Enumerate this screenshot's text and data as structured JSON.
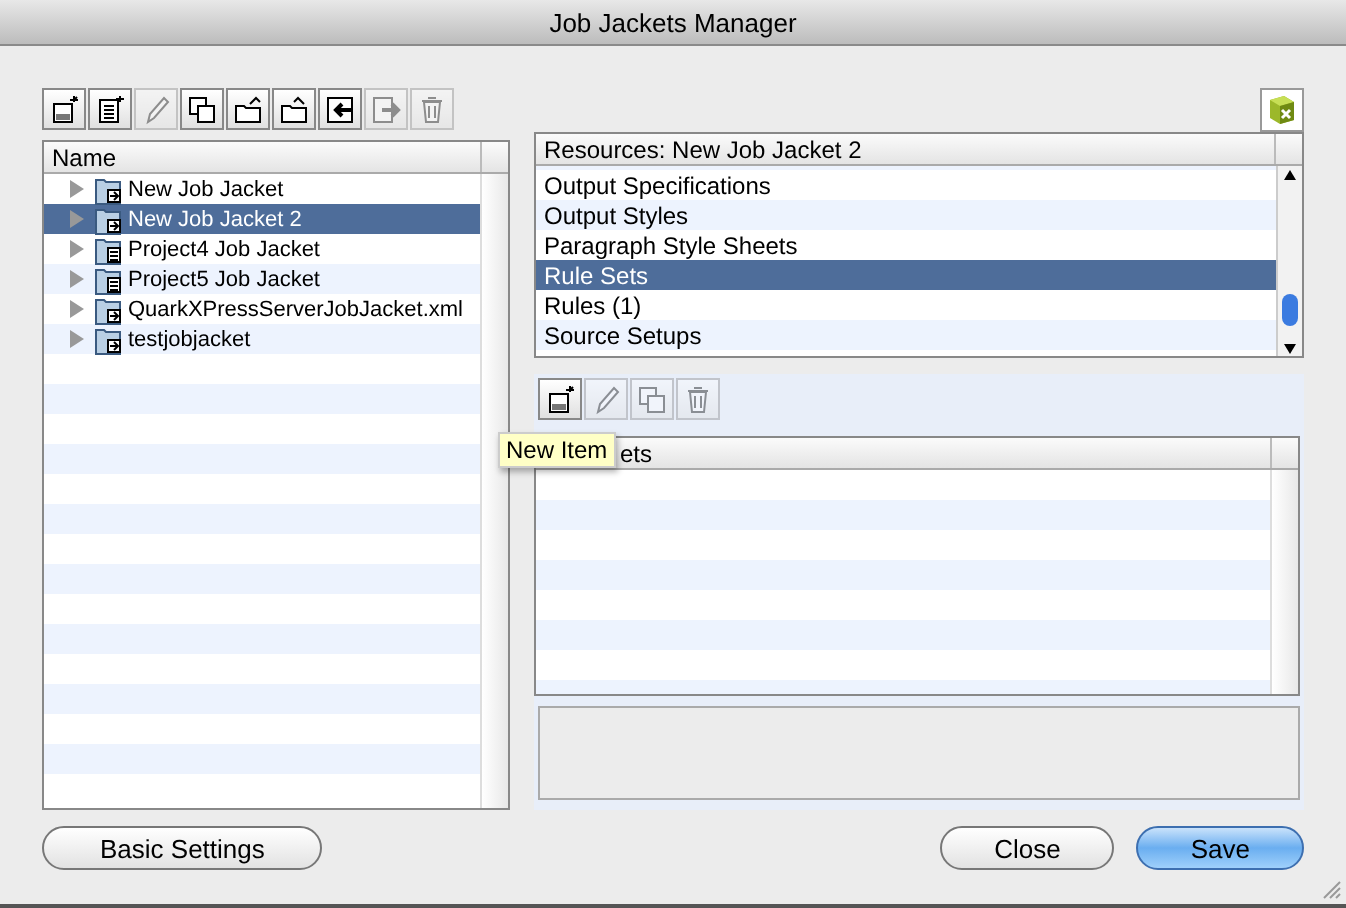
{
  "window": {
    "title": "Job Jackets Manager"
  },
  "jackets_toolbar": [
    {
      "kind": "new",
      "disabled": false
    },
    {
      "kind": "new-list",
      "disabled": false
    },
    {
      "kind": "edit",
      "disabled": true
    },
    {
      "kind": "duplicate",
      "disabled": false
    },
    {
      "kind": "open",
      "disabled": false
    },
    {
      "kind": "open-back",
      "disabled": false
    },
    {
      "kind": "import",
      "disabled": false
    },
    {
      "kind": "export",
      "disabled": true
    },
    {
      "kind": "delete",
      "disabled": true
    }
  ],
  "jackets": {
    "column": "Name",
    "rows": [
      {
        "name": "New Job Jacket",
        "kind": "linked",
        "expanded": false,
        "selected": false
      },
      {
        "name": "New Job Jacket 2",
        "kind": "linked",
        "expanded": false,
        "selected": true
      },
      {
        "name": "Project4 Job Jacket",
        "kind": "stored",
        "expanded": false,
        "selected": false
      },
      {
        "name": "Project5 Job Jacket",
        "kind": "stored",
        "expanded": false,
        "selected": false
      },
      {
        "name": "QuarkXPressServerJobJacket.xml",
        "kind": "linked",
        "expanded": false,
        "selected": false
      },
      {
        "name": "testjobjacket",
        "kind": "linked",
        "expanded": false,
        "selected": false
      }
    ]
  },
  "resources": {
    "column": "Resources: New Job Jacket 2",
    "rows": [
      {
        "name": "Output Specifications",
        "selected": false
      },
      {
        "name": "Output Styles",
        "selected": false
      },
      {
        "name": "Paragraph Style Sheets",
        "selected": false
      },
      {
        "name": "Rule Sets",
        "selected": true
      },
      {
        "name": "Rules (1)",
        "selected": false
      },
      {
        "name": "Source Setups",
        "selected": false
      }
    ]
  },
  "items_toolbar": [
    {
      "kind": "new",
      "disabled": false
    },
    {
      "kind": "edit",
      "disabled": true
    },
    {
      "kind": "duplicate",
      "disabled": true
    },
    {
      "kind": "delete",
      "disabled": true
    }
  ],
  "tooltip": "New Item",
  "items": {
    "column": "ets"
  },
  "buttons": [
    {
      "label": "Basic Settings",
      "default": false
    },
    {
      "label": "Close",
      "default": false
    },
    {
      "label": "Save",
      "default": true
    }
  ]
}
